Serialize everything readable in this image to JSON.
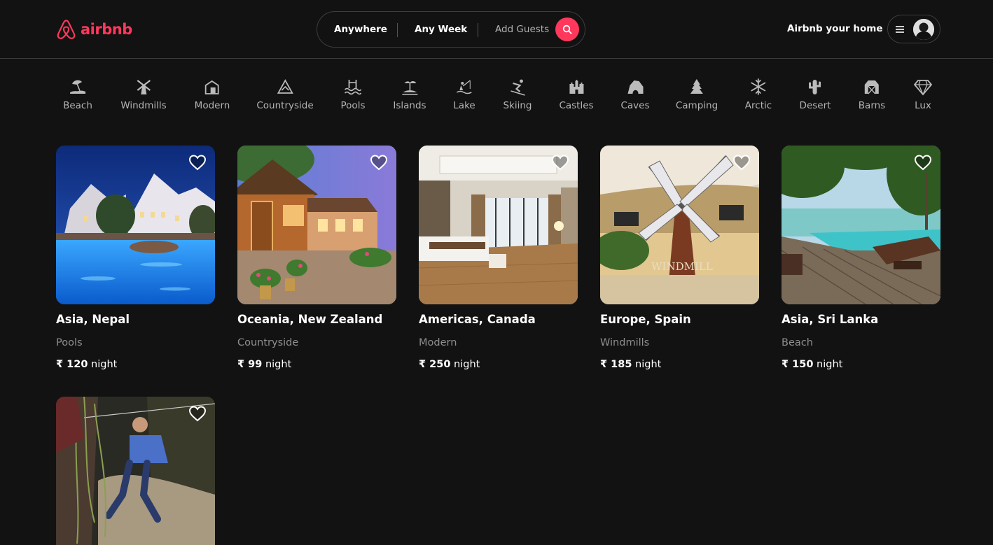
{
  "brand": {
    "name": "airbnb",
    "color": "#ff385c"
  },
  "search": {
    "location": "Anywhere",
    "week": "Any Week",
    "guests_placeholder": "Add Guests",
    "search_icon": "search-icon"
  },
  "header": {
    "host_link": "Airbnb your home",
    "menu_icon": "hamburger-icon",
    "avatar_icon": "user-avatar"
  },
  "categories": [
    {
      "label": "Beach",
      "icon": "beach-icon"
    },
    {
      "label": "Windmills",
      "icon": "windmill-icon"
    },
    {
      "label": "Modern",
      "icon": "modern-house-icon"
    },
    {
      "label": "Countryside",
      "icon": "countryside-icon"
    },
    {
      "label": "Pools",
      "icon": "pool-icon"
    },
    {
      "label": "Islands",
      "icon": "island-icon"
    },
    {
      "label": "Lake",
      "icon": "lake-icon"
    },
    {
      "label": "Skiing",
      "icon": "skiing-icon"
    },
    {
      "label": "Castles",
      "icon": "castle-icon"
    },
    {
      "label": "Caves",
      "icon": "cave-icon"
    },
    {
      "label": "Camping",
      "icon": "camping-icon"
    },
    {
      "label": "Arctic",
      "icon": "snowflake-icon"
    },
    {
      "label": "Desert",
      "icon": "cactus-icon"
    },
    {
      "label": "Barns",
      "icon": "barn-icon"
    },
    {
      "label": "Lux",
      "icon": "diamond-icon"
    }
  ],
  "listings": [
    {
      "title": "Asia, Nepal",
      "category": "Pools",
      "currency": "₹",
      "price": "120",
      "unit": "night"
    },
    {
      "title": "Oceania, New Zealand",
      "category": "Countryside",
      "currency": "₹",
      "price": "99",
      "unit": "night"
    },
    {
      "title": "Americas, Canada",
      "category": "Modern",
      "currency": "₹",
      "price": "250",
      "unit": "night"
    },
    {
      "title": "Europe, Spain",
      "category": "Windmills",
      "currency": "₹",
      "price": "185",
      "unit": "night"
    },
    {
      "title": "Asia, Sri Lanka",
      "category": "Beach",
      "currency": "₹",
      "price": "150",
      "unit": "night"
    },
    {
      "title": "",
      "category": "",
      "currency": "",
      "price": "",
      "unit": ""
    }
  ]
}
